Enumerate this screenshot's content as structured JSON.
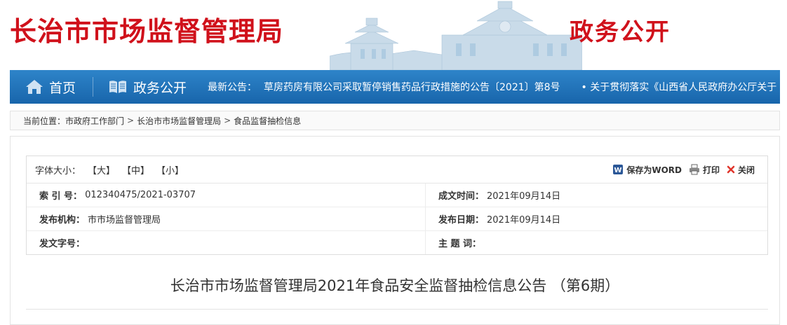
{
  "header": {
    "site_title": "长治市市场监督管理局",
    "section_title": "政务公开"
  },
  "nav": {
    "home_label": "首页",
    "gov_label": "政务公开",
    "ticker_label": "最新公告：",
    "ticker_items": [
      "县草房药房有限公司采取暂停销售药品行政措施的公告〔2021〕第8号",
      "• 关于贯彻落实《山西省人民政府办公厅关于"
    ]
  },
  "breadcrumb": {
    "label": "当前位置：",
    "items": [
      "市政府工作部门",
      "长治市市场监督管理局",
      "食品监督抽检信息"
    ],
    "separator": ">"
  },
  "toolbar": {
    "font_size_label": "字体大小：",
    "font_large": "【大】",
    "font_medium": "【中】",
    "font_small": "【小】",
    "save_word": "保存为WORD",
    "print": "打印",
    "close": "关闭"
  },
  "meta": {
    "index_key": "索  引 号：",
    "index_value": "012340475/2021-03707",
    "created_key": "成文时间：",
    "created_value": "2021年09月14日",
    "org_key": "发布机构：",
    "org_value": "市市场监督管理局",
    "pub_key": "发布日期：",
    "pub_value": "2021年09月14日",
    "docno_key": "发文字号：",
    "docno_value": "",
    "subject_key": "主  题 词：",
    "subject_value": ""
  },
  "article": {
    "title": "长治市市场监督管理局2021年食品安全监督抽检信息公告 （第6期）"
  },
  "colors": {
    "brand_red": "#d0111b",
    "nav_blue": "#1e6fb6"
  }
}
